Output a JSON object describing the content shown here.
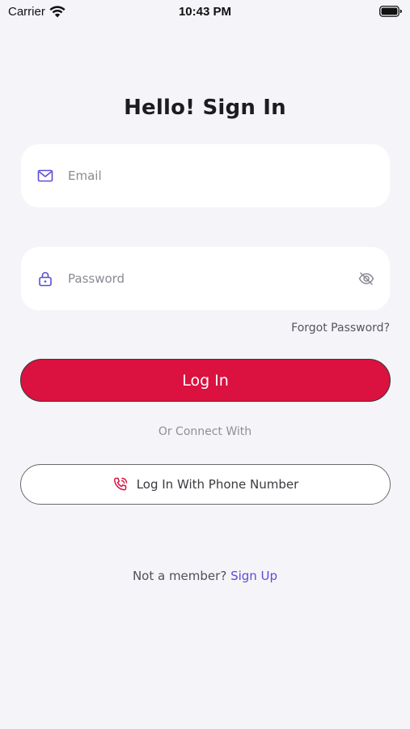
{
  "status_bar": {
    "carrier": "Carrier",
    "time": "10:43 PM",
    "icons": [
      "wifi-icon",
      "battery-icon"
    ]
  },
  "title": "Hello! Sign In",
  "email": {
    "value": "",
    "placeholder": "Email",
    "icon": "mail-icon"
  },
  "password": {
    "value": "",
    "placeholder": "Password",
    "icon": "lock-icon",
    "toggle_icon": "eye-off-icon"
  },
  "forgot_password": "Forgot Password?",
  "login_button": "Log In",
  "or_connect": "Or Connect With",
  "phone_button": {
    "label": "Log In With Phone Number",
    "icon": "phone-icon"
  },
  "signup": {
    "prompt": "Not a member?",
    "link": "Sign Up"
  },
  "colors": {
    "background": "#f5f4f9",
    "primary": "#db1140",
    "accent": "#5b4ed3",
    "field": "#ffffff"
  }
}
